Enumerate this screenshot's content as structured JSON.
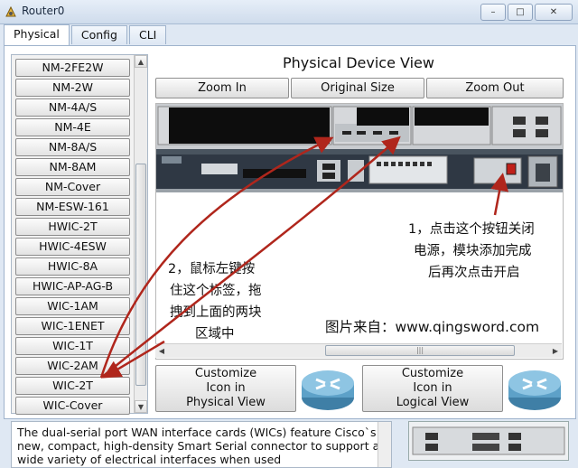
{
  "window": {
    "title": "Router0",
    "buttons": [
      "–",
      "□",
      "✕"
    ]
  },
  "tabs": [
    {
      "label": "Physical",
      "active": true
    },
    {
      "label": "Config",
      "active": false
    },
    {
      "label": "CLI",
      "active": false
    }
  ],
  "modules": [
    "NM-2FE2W",
    "NM-2W",
    "NM-4A/S",
    "NM-4E",
    "NM-8A/S",
    "NM-8AM",
    "NM-Cover",
    "NM-ESW-161",
    "HWIC-2T",
    "HWIC-4ESW",
    "HWIC-8A",
    "HWIC-AP-AG-B",
    "WIC-1AM",
    "WIC-1ENET",
    "WIC-1T",
    "WIC-2AM",
    "WIC-2T",
    "WIC-Cover"
  ],
  "device_view": {
    "title": "Physical Device View",
    "zoom_in": "Zoom In",
    "original_size": "Original Size",
    "zoom_out": "Zoom Out",
    "scrollbar_grip": "|||"
  },
  "customize": {
    "physical": "Customize\nIcon in\nPhysical View",
    "logical": "Customize\nIcon in\nLogical View"
  },
  "description": "The dual-serial port WAN interface cards (WICs) feature Cisco`s new, compact, high-density Smart Serial connector to support a wide variety of electrical interfaces when used",
  "annotations": {
    "note1_line1": "1，点击这个按钮关闭",
    "note1_line2": "电源，模块添加完成",
    "note1_line3": "后再次点击开启",
    "note2_line1": "2，鼠标左键按",
    "note2_line2": "住这个标签，拖",
    "note2_line3": "拽到上面的两块",
    "note2_line4": "区域中",
    "watermark": "图片来自：www.qingsword.com"
  },
  "colors": {
    "arrow": "#b0261c",
    "router_body": "#2f3844",
    "slot_black": "#0d0d0d"
  }
}
